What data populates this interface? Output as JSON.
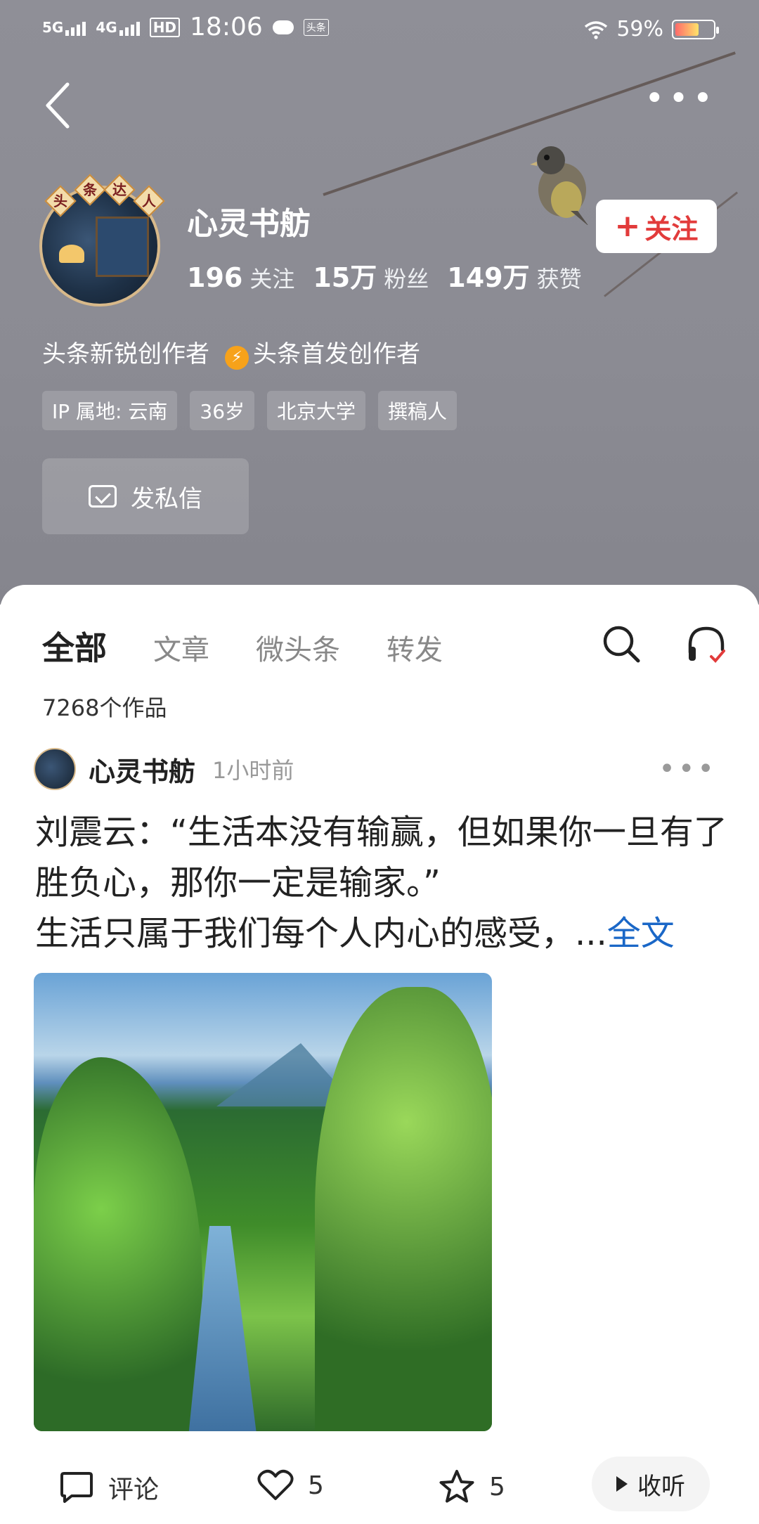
{
  "status_bar": {
    "signal_1": "5G",
    "signal_2": "4G",
    "hd": "HD",
    "time": "18:06",
    "app_badge": "头条",
    "battery": "59%",
    "battery_level": 0.59
  },
  "profile": {
    "avatar_badge": [
      "头",
      "条",
      "达",
      "人"
    ],
    "name": "心灵书舫",
    "stats": [
      {
        "num": "196",
        "label": "关注"
      },
      {
        "num": "15万",
        "label": "粉丝"
      },
      {
        "num": "149万",
        "label": "获赞"
      }
    ],
    "follow_label": "关注",
    "creator_titles": [
      "头条新锐创作者",
      "头条首发创作者"
    ],
    "tags": [
      "IP 属地: 云南",
      "36岁",
      "北京大学",
      "撰稿人"
    ],
    "dm_label": "发私信"
  },
  "tabs": [
    "全部",
    "文章",
    "微头条",
    "转发"
  ],
  "works_count": "7268个作品",
  "post": {
    "author": "心灵书舫",
    "time": "1小时前",
    "text_line1": "刘震云：“生活本没有输赢，但如果你一旦有了胜负心，那你一定是输家。”",
    "text_line2": "生活只属于我们每个人内心的感受，...",
    "full_text_link": "全文",
    "actions": {
      "comment": "评论",
      "likes": "5",
      "favorites": "5",
      "listen": "收听"
    }
  },
  "colors": {
    "header_bg": "#8b8b93",
    "follow_red": "#e23b3b",
    "link_blue": "#1a67c7",
    "bolt_orange": "#f7a21a"
  }
}
